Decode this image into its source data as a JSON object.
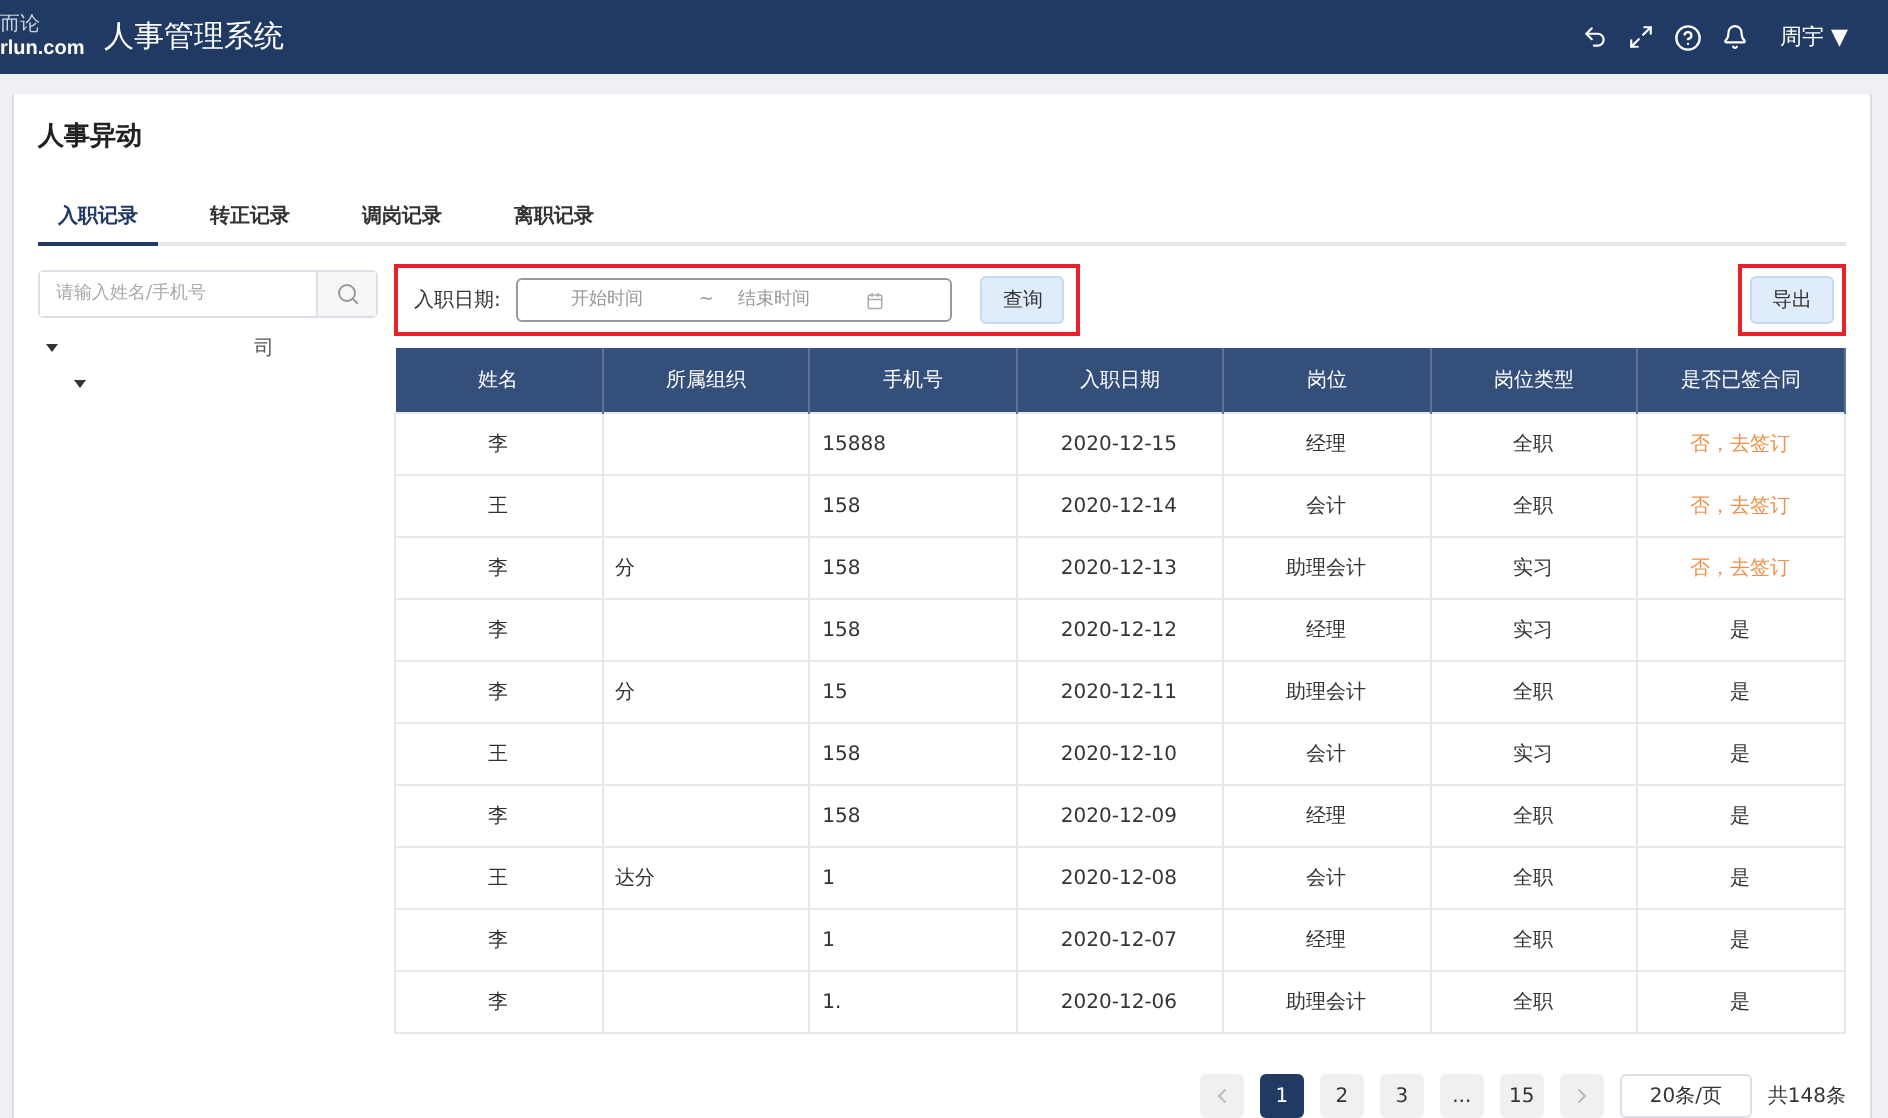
{
  "header": {
    "logo_top": "而论",
    "logo_bottom": "rlun.com",
    "title": "人事管理系统",
    "user": "周宇",
    "user_caret": "▼"
  },
  "page_title": "人事异动",
  "tabs": [
    {
      "label": "入职记录",
      "selected": true
    },
    {
      "label": "转正记录",
      "selected": false
    },
    {
      "label": "调岗记录",
      "selected": false
    },
    {
      "label": "离职记录",
      "selected": false
    }
  ],
  "sidebar": {
    "search": {
      "placeholder": "请输入姓名/手机号"
    },
    "tree": [
      {
        "label": "司",
        "expanded": true,
        "children": [
          {
            "expanded": true
          }
        ]
      }
    ]
  },
  "filter": {
    "label": "入职日期:",
    "start_placeholder": "开始时间",
    "separator": "~",
    "end_placeholder": "结束时间",
    "query_button": "查询"
  },
  "export_button": "导出",
  "table": {
    "columns": [
      "姓名",
      "所属组织",
      "手机号",
      "入职日期",
      "岗位",
      "岗位类型",
      "是否已签合同"
    ],
    "rows": [
      {
        "cells": [
          "李",
          "",
          "15888",
          "2020-12-15",
          "经理",
          "全职",
          "否，去签订"
        ],
        "signed": false
      },
      {
        "cells": [
          "王",
          "",
          "158",
          "2020-12-14",
          "会计",
          "全职",
          "否，去签订"
        ],
        "signed": false
      },
      {
        "cells": [
          "李",
          "分",
          "158",
          "2020-12-13",
          "助理会计",
          "实习",
          "否，去签订"
        ],
        "signed": false
      },
      {
        "cells": [
          "李",
          "",
          "158",
          "2020-12-12",
          "经理",
          "实习",
          "是"
        ],
        "signed": true
      },
      {
        "cells": [
          "李",
          "分",
          "15",
          "2020-12-11",
          "助理会计",
          "全职",
          "是"
        ],
        "signed": true
      },
      {
        "cells": [
          "王",
          "",
          "158",
          "2020-12-10",
          "会计",
          "实习",
          "是"
        ],
        "signed": true
      },
      {
        "cells": [
          "李",
          "",
          "158",
          "2020-12-09",
          "经理",
          "全职",
          "是"
        ],
        "signed": true
      },
      {
        "cells": [
          "王",
          "达分",
          "1",
          "2020-12-08",
          "会计",
          "全职",
          "是"
        ],
        "signed": true
      },
      {
        "cells": [
          "李",
          "",
          "1",
          "2020-12-07",
          "经理",
          "全职",
          "是"
        ],
        "signed": true
      },
      {
        "cells": [
          "李",
          "",
          "1.",
          "2020-12-06",
          "助理会计",
          "全职",
          "是"
        ],
        "signed": true
      }
    ]
  },
  "pagination": {
    "pages": [
      {
        "label": "1",
        "selected": true
      },
      {
        "label": "2",
        "selected": false
      },
      {
        "label": "3",
        "selected": false
      },
      {
        "label": "...",
        "selected": false
      },
      {
        "label": "15",
        "selected": false
      }
    ],
    "page_size": "20条/页",
    "total": "共148条"
  }
}
